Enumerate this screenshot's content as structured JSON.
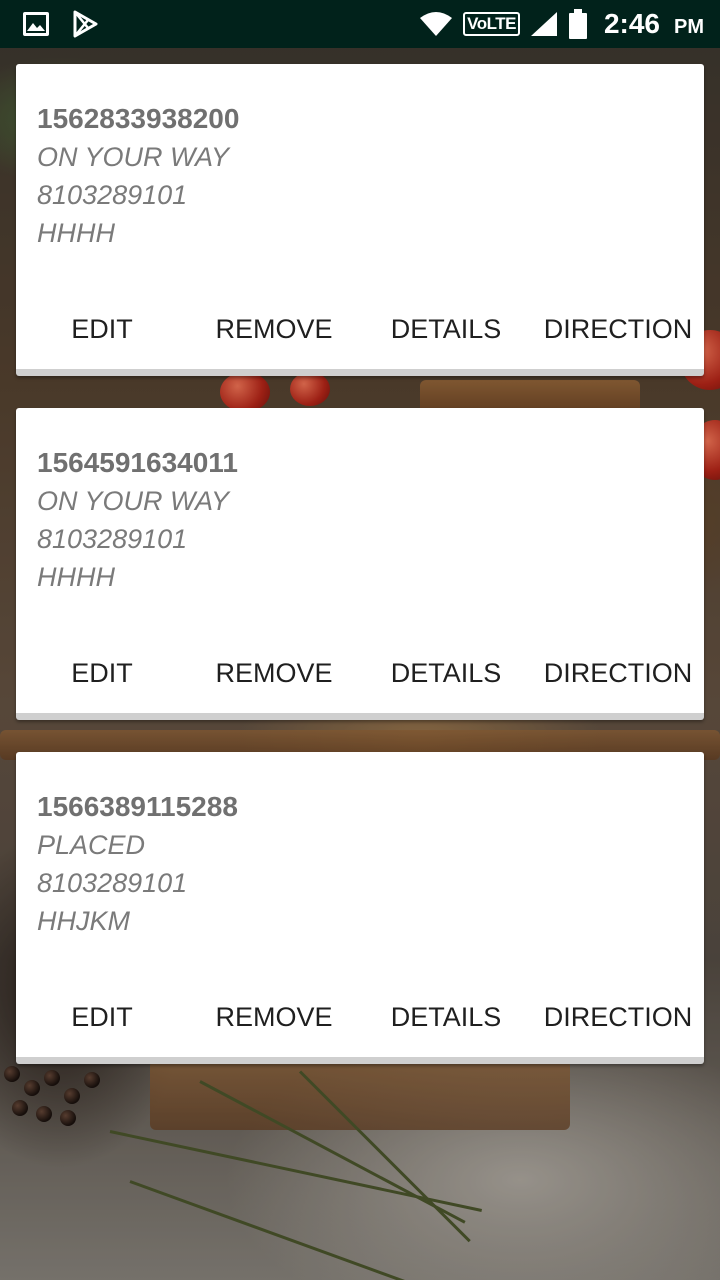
{
  "status_bar": {
    "left_icons": [
      "image-icon",
      "play-store-icon"
    ],
    "volte": "VoLTE",
    "time": "2:46",
    "time_suffix": "PM"
  },
  "orders": [
    {
      "id": "1562833938200",
      "status": "ON YOUR WAY",
      "phone": "8103289101",
      "note": "HHHH",
      "actions": [
        "EDIT",
        "REMOVE",
        "DETAILS",
        "DIRECTION"
      ]
    },
    {
      "id": "1564591634011",
      "status": "ON YOUR WAY",
      "phone": "8103289101",
      "note": "HHHH",
      "actions": [
        "EDIT",
        "REMOVE",
        "DETAILS",
        "DIRECTION"
      ]
    },
    {
      "id": "1566389115288",
      "status": "PLACED",
      "phone": "8103289101",
      "note": "HHJKM",
      "actions": [
        "EDIT",
        "REMOVE",
        "DETAILS",
        "DIRECTION"
      ]
    }
  ]
}
